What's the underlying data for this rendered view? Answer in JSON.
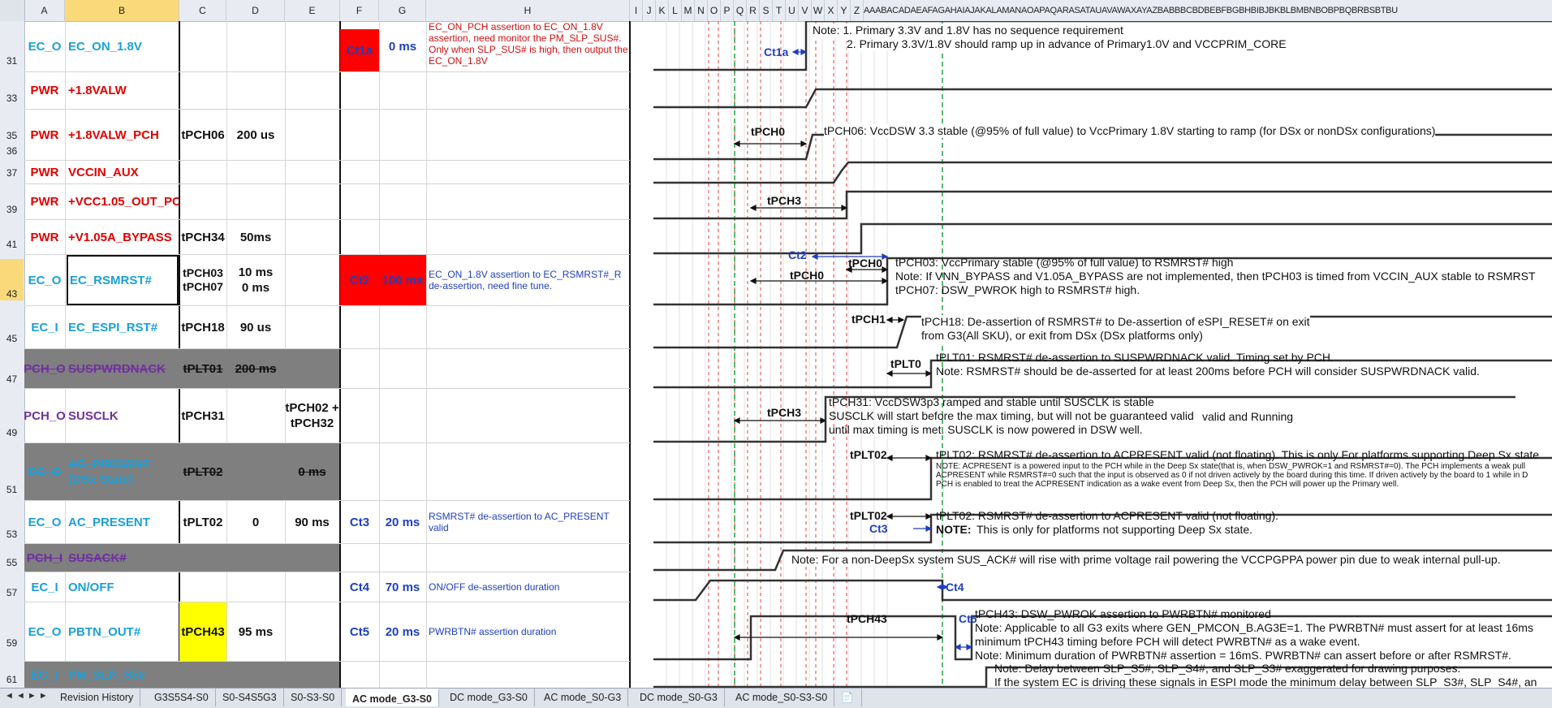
{
  "columns": [
    "A",
    "B",
    "C",
    "D",
    "E",
    "F",
    "G",
    "H",
    "I",
    "J",
    "K",
    "L",
    "M",
    "N",
    "O",
    "P",
    "Q",
    "R",
    "S",
    "T",
    "U",
    "V",
    "W",
    "X",
    "Y",
    "Z"
  ],
  "columns_tail": "AAABACADAEAFAGAHAIAJAKALAMANAOAPAQARASATAUAVAWAXAYAZBABBBCBDBEBFBGBHBIBJBKBLBMBNBOBPBQBRBSBTBU",
  "rows": [
    {
      "num": "31",
      "type": "EC_O",
      "signal": "EC_ON_1.8V",
      "param": "",
      "val1": "",
      "val2": "",
      "ct": "Ct1a",
      "ctval": "0 ms",
      "desc": "EC_ON_PCH assertion to EC_ON_1.8V assertion, need monitor the PM_SLP_SUS#. Only when SLP_SUS# is high, then output the EC_ON_1.8V"
    },
    {
      "num": "33",
      "type": "PWR",
      "signal": "+1.8VALW",
      "param": "",
      "val1": "",
      "val2": "",
      "ct": "",
      "ctval": "",
      "desc": ""
    },
    {
      "num": "35",
      "type": "PWR",
      "signal": "+1.8VALW_PCH",
      "param": "tPCH06",
      "val1": "200 us",
      "val2": "",
      "ct": "",
      "ctval": "",
      "desc": ""
    },
    {
      "num": "37",
      "type": "PWR",
      "signal": "VCCIN_AUX",
      "param": "",
      "val1": "",
      "val2": "",
      "ct": "",
      "ctval": "",
      "desc": ""
    },
    {
      "num": "39",
      "type": "PWR",
      "signal": "+VCC1.05_OUT_PCH",
      "param": "",
      "val1": "",
      "val2": "",
      "ct": "",
      "ctval": "",
      "desc": ""
    },
    {
      "num": "41",
      "type": "PWR",
      "signal": "+V1.05A_BYPASS",
      "param": "tPCH34",
      "val1": "50ms",
      "val2": "",
      "ct": "",
      "ctval": "",
      "desc": ""
    },
    {
      "num": "43",
      "type": "EC_O",
      "signal": "EC_RSMRST#",
      "param": "tPCH03 tPCH07",
      "val1": "10 ms\n0 ms",
      "val2": "",
      "ct": "Ct2",
      "ctval": "100 ms",
      "desc": "EC_ON_1.8V assertion to EC_RSMRST#_R de-assertion, need fine tune."
    },
    {
      "num": "45",
      "type": "EC_I",
      "signal": "EC_ESPI_RST#",
      "param": "tPCH18",
      "val1": "90 us",
      "val2": "",
      "ct": "",
      "ctval": "",
      "desc": ""
    },
    {
      "num": "47",
      "type": "PCH_O",
      "signal": "SUSPWRDNACK",
      "param": "tPLT01",
      "val1": "200 ms",
      "val2": "",
      "ct": "",
      "ctval": "",
      "desc": ""
    },
    {
      "num": "49",
      "type": "PCH_O",
      "signal": "SUSCLK",
      "param": "tPCH31",
      "val1": "",
      "val2": "tPCH02 + tPCH32",
      "ct": "",
      "ctval": "",
      "desc": ""
    },
    {
      "num": "51",
      "type": "EC_O",
      "signal": "AC_PRESENT (DSx State)",
      "param": "tPLT02",
      "val1": "",
      "val2": "0 ms",
      "ct": "",
      "ctval": "",
      "desc": ""
    },
    {
      "num": "53",
      "type": "EC_O",
      "signal": "AC_PRESENT",
      "param": "tPLT02",
      "val1": "0",
      "val2": "90 ms",
      "ct": "Ct3",
      "ctval": "20 ms",
      "desc": "RSMRST# de-assertion to AC_PRESENT valid"
    },
    {
      "num": "55",
      "type": "PCH_I",
      "signal": "SUSACK#",
      "param": "",
      "val1": "",
      "val2": "",
      "ct": "",
      "ctval": "",
      "desc": ""
    },
    {
      "num": "57",
      "type": "EC_I",
      "signal": "ON/OFF",
      "param": "",
      "val1": "",
      "val2": "",
      "ct": "Ct4",
      "ctval": "70 ms",
      "desc": "ON/OFF de-assertion duration"
    },
    {
      "num": "59",
      "type": "EC_O",
      "signal": "PBTN_OUT#",
      "param": "tPCH43",
      "val1": "95 ms",
      "val2": "",
      "ct": "Ct5",
      "ctval": "20 ms",
      "desc": "PWRBTN# assertion duration"
    },
    {
      "num": "61",
      "type": "EC_I",
      "signal": "PM_SLP_S5#",
      "param": "",
      "val1": "",
      "val2": "",
      "ct": "",
      "ctval": "",
      "desc": ""
    }
  ],
  "extra_rownums": [
    "36"
  ],
  "timing": {
    "labels": {
      "ct1a": "Ct1a",
      "tpch0a": "tPCH0",
      "tpch3a": "tPCH3",
      "ct2": "Ct2",
      "tpch0b": "tPCH0",
      "tpch0c": "tPCH0",
      "tpch1": "tPCH1",
      "tplt0": "tPLT0",
      "tpch3b": "tPCH3",
      "tplt02a": "tPLT02",
      "tplt02b": "tPLT02",
      "ct3": "Ct3",
      "ct4": "Ct4",
      "tpch43": "tPCH43",
      "ct5": "Ct5"
    },
    "notes": {
      "n31a": "Note:  1. Primary 3.3V and 1.8V has no sequence requirement",
      "n31b": "2. Primary 3.3V/1.8V should ramp up in advance of Primary1.0V and VCCPRIM_CORE",
      "n35": "tPCH06: VccDSW 3.3 stable (@95% of full value) to VccPrimary 1.8V starting to ramp (for DSx or nonDSx configurations)",
      "n43a": "tPCH03: VccPrimary stable (@95% of full value) to RSMRST# high",
      "n43b": "Note: If VNN_BYPASS and V1.05A_BYPASS are not implemented, then tPCH03 is timed from VCCIN_AUX stable to RSMRST",
      "n43c": "tPCH07: DSW_PWROK high to RSMRST# high.",
      "n45a": "tPCH18: De-assertion of RSMRST# to De-assertion of eSPI_RESET# on exit",
      "n45b": "from G3(All SKU), or exit from DSx (DSx platforms only)",
      "n47a": "tPLT01: RSMRST# de-assertion to SUSPWRDNACK valid.  Timing set by PCH.",
      "n47b": "Note: RSMRST# should be de-asserted for at least 200ms before PCH will consider SUSPWRDNACK valid.",
      "n49a": "tPCH31: VccDSW3p3 ramped and stable until SUSCLK is stable",
      "n49b": "SUSCLK will start before the max timing, but will not be guaranteed valid",
      "n49b2": "valid and Running",
      "n49c": "until max timing is met. SUSCLK is now powered in DSW well.",
      "n51a": "tPLT02: RSMRST# de-assertion to ACPRESENT valid (not floating). This is only For platforms supporting Deep Sx state",
      "n51b": "NOTE:  ACPRESENT  is a powered input to the PCH  while in the Deep Sx state(that is, when DSW_PWROK=1 and RSMRST#=0).  The PCH  implements  a weak pull",
      "n51c": "ACPRESENT   while RSMRST#=0  such that the input is observed as 0 if not driven actively by the board during this time.  If driven actively by the board to 1  while in D",
      "n51d": "PCH  is enabled to treat the ACPRESENT  indication as a wake event from Deep Sx, then the PCH  will power up the Primary  well.",
      "n53a": "tPLT02: RSMRST# de-assertion to ACPRESENT valid (not floating).",
      "n53b": "NOTE:",
      "n53c": "This is only for platforms not supporting Deep Sx state.",
      "n55": "Note: For a non-DeepSx system SUS_ACK# will rise with prime voltage rail powering the VCCPGPPA power pin due to weak internal pull-up.",
      "n59a": "tPCH43: DSW_PWROK assertion to PWRBTN# monitored",
      "n59b": "Note: Applicable to all G3 exits where GEN_PMCON_B.AG3E=1.  The PWRBTN# must assert for at least 16ms",
      "n59c": "minimum tPCH43 timing before PCH will detect PWRBTN# as a wake event.",
      "n59d": "Note: Minimum duration of PWRBTN# assertion = 16mS. PWRBTN# can assert before or after RSMRST#.",
      "n61a": "Note: Delay between SLP_S5#, SLP_S4#, and SLP_S3# exaggerated for drawing purposes.",
      "n61b": "If the system EC is driving these signals in ESPI mode the minimum delay between SLP_S3#, SLP_S4#, an"
    }
  },
  "tabs": [
    "Revision History",
    "G3S5S4-S0",
    "S0-S4S5G3",
    "S0-S3-S0",
    "AC mode_G3-S0",
    "DC mode_G3-S0",
    "AC mode_S0-G3",
    "DC mode_S0-G3",
    "AC mode_S0-S3-S0"
  ],
  "active_tab": "AC mode_G3-S0",
  "tab_nav": "◄ ◄ ► ►",
  "colors": {
    "ec": "#1aa0d8",
    "pwr": "#e00000",
    "pch": "#7030a0",
    "blue": "#1f3fbf",
    "red": "#ff0000",
    "yellow": "#ffff00",
    "gray": "#7f7f7f"
  }
}
